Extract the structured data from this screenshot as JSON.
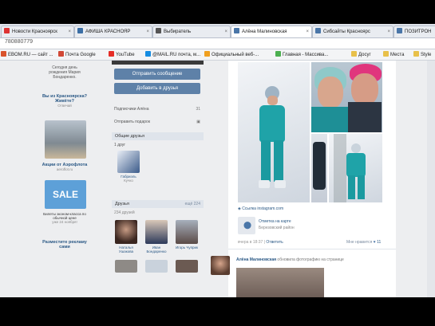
{
  "tabs": [
    {
      "label": "Новости Красноярск",
      "fav_color": "#d33",
      "active": false
    },
    {
      "label": "АФИША КРАСНОЯР",
      "fav_color": "#3a6ea5",
      "active": false
    },
    {
      "label": "Выбиратель",
      "fav_color": "#555",
      "active": false
    },
    {
      "label": "Алёна Малиновская",
      "fav_color": "#4a76a8",
      "active": true
    },
    {
      "label": "Сибсайты Красноярс",
      "fav_color": "#4a76a8",
      "active": false
    },
    {
      "label": "ПОЗИТРОН",
      "fav_color": "#4a76a8",
      "active": false
    }
  ],
  "url": "780880779",
  "bookmarks": [
    {
      "label": "EBOM.RU — сайт ...",
      "color": "#d9532c"
    },
    {
      "label": "Почта Google",
      "color": "#d14836"
    },
    {
      "label": "YouTube",
      "color": "#e52d27"
    },
    {
      "label": "@MAIL.RU почта, м...",
      "color": "#168de2"
    },
    {
      "label": "Официальный веб-...",
      "color": "#f0a020"
    },
    {
      "label": "Главная - Массива...",
      "color": "#4caf50"
    },
    {
      "label": "Досуг",
      "color": "#e8c04a"
    },
    {
      "label": "Места",
      "color": "#e8c04a"
    },
    {
      "label": "Style",
      "color": "#e8c04a"
    }
  ],
  "left": {
    "promo_line1": "Сегодня день",
    "promo_line2": "рождения Мария",
    "promo_line3": "Бондаренко.",
    "ad1_title": "Вы из Красноярска?",
    "ad1_sub": "Живёте?",
    "ad1_link": "Отвечай",
    "ad2_title": "Акции от Аэрофлота",
    "ad2_sub": "aeroflot.ru",
    "ad3_title": "Билеты эконом-класса по обычной цене",
    "ad3_sub": "уже 24 ноября!",
    "ad4_title": "Разместите рекламу сами",
    "sale_text": "SALE"
  },
  "middle": {
    "send_message": "Отправить сообщение",
    "add_friend": "Добавить в друзья",
    "subscribers_label": "Подписчики Алёна",
    "subscribers_count": "31",
    "gifts_label": "Отправить подарок",
    "common_friends_header": "Общие друзья",
    "common_friends_count": "1 друг",
    "common_friend_name": "Габриэль",
    "common_friend_sub": "Кучко",
    "friends_header": "Друзья",
    "friends_all": "ещё 224",
    "friends_count": "234 друзей",
    "friends": [
      {
        "name": "Наталья Ушакова"
      },
      {
        "name": "Иван Бондаренко"
      },
      {
        "name": "Игорь Чуприк"
      }
    ]
  },
  "right": {
    "instagram_link": "Ссылка instagram.com",
    "map_line1": "Отметка на карте",
    "map_line2": "Березовский район",
    "post_time": "вчера в 18:37",
    "reply": "Ответить",
    "likes_label": "Мне нравится",
    "likes_count": "11",
    "author": "Алёна Малиновская",
    "author_action": "обновила фотографию на странице"
  }
}
